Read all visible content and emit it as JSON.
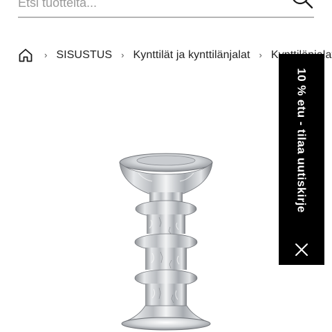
{
  "search": {
    "placeholder": "Etsi tuotteita..."
  },
  "breadcrumb": {
    "items": [
      {
        "label": "SISUSTUS"
      },
      {
        "label": "Kynttilät ja kynttilänjalat"
      },
      {
        "label": "Kynttilänjalat"
      }
    ]
  },
  "newsletter": {
    "label": "10 % etu - tilaa uutiskirje"
  },
  "icons": {
    "search": "search-icon",
    "home": "home-icon",
    "chevron": "chevron-right-icon",
    "close": "close-icon"
  },
  "colors": {
    "newsletter_bg": "#000000",
    "newsletter_text": "#ffffff",
    "search_underline": "#b5b5b5"
  }
}
